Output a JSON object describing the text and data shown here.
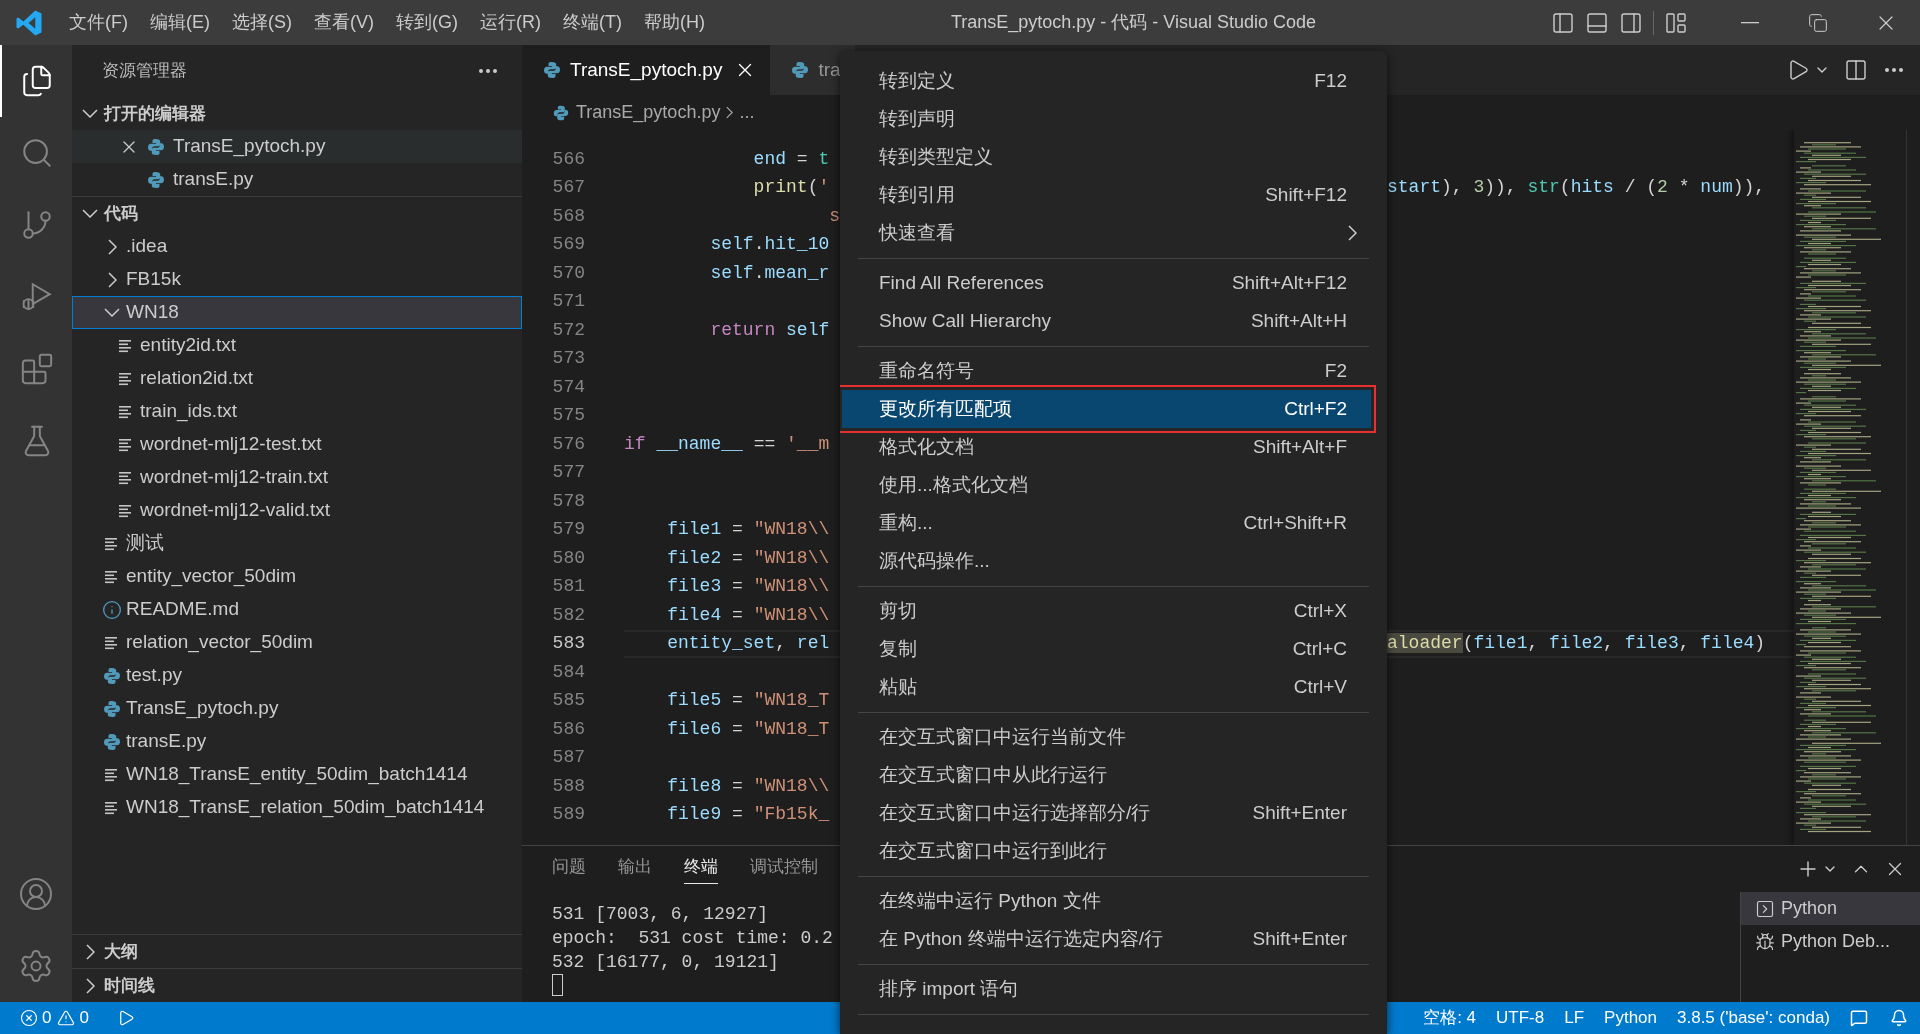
{
  "title_bar": {
    "menus": [
      "文件(F)",
      "编辑(E)",
      "选择(S)",
      "查看(V)",
      "转到(G)",
      "运行(R)",
      "终端(T)",
      "帮助(H)"
    ],
    "title": "TransE_pytoch.py - 代码 - Visual Studio Code"
  },
  "activity_bar": [
    {
      "kind": "files",
      "selected": true
    },
    {
      "kind": "search",
      "selected": false
    },
    {
      "kind": "scm",
      "selected": false
    },
    {
      "kind": "debug",
      "selected": false
    },
    {
      "kind": "extensions",
      "selected": false
    },
    {
      "kind": "testing",
      "selected": false
    }
  ],
  "explorer": {
    "title": "资源管理器",
    "open_editors": {
      "title": "打开的编辑器",
      "expanded": true,
      "items": [
        {
          "name": "TransE_pytoch.py",
          "selected": true
        },
        {
          "name": "transE.py",
          "selected": false
        }
      ]
    },
    "folder": {
      "title": "代码",
      "expanded": true,
      "items": [
        {
          "name": ".idea",
          "kind": "folder",
          "expanded": false,
          "selected": false
        },
        {
          "name": "FB15k",
          "kind": "folder",
          "expanded": false,
          "selected": false
        },
        {
          "name": "WN18",
          "kind": "folder",
          "expanded": true,
          "selected": true,
          "children": [
            {
              "name": "entity2id.txt",
              "kind": "text",
              "selected": false
            },
            {
              "name": "relation2id.txt",
              "kind": "text",
              "selected": false
            },
            {
              "name": "train_ids.txt",
              "kind": "text",
              "selected": false
            },
            {
              "name": "wordnet-mlj12-test.txt",
              "kind": "text",
              "selected": false
            },
            {
              "name": "wordnet-mlj12-train.txt",
              "kind": "text",
              "selected": false
            },
            {
              "name": "wordnet-mlj12-valid.txt",
              "kind": "text",
              "selected": false
            }
          ]
        },
        {
          "name": "测试",
          "kind": "text",
          "selected": false
        },
        {
          "name": "entity_vector_50dim",
          "kind": "text",
          "selected": false
        },
        {
          "name": "README.md",
          "kind": "info",
          "selected": false
        },
        {
          "name": "relation_vector_50dim",
          "kind": "text",
          "selected": false
        },
        {
          "name": "test.py",
          "kind": "python",
          "selected": false
        },
        {
          "name": "TransE_pytoch.py",
          "kind": "python",
          "selected": false
        },
        {
          "name": "transE.py",
          "kind": "python",
          "selected": false
        },
        {
          "name": "WN18_TransE_entity_50dim_batch1414",
          "kind": "text",
          "selected": false
        },
        {
          "name": "WN18_TransE_relation_50dim_batch1414",
          "kind": "text",
          "selected": false
        }
      ]
    },
    "bottom_sections": [
      {
        "title": "大纲",
        "expanded": false
      },
      {
        "title": "时间线",
        "expanded": false
      }
    ]
  },
  "editor": {
    "tabs": [
      {
        "label": "TransE_pytoch.py",
        "selected": true
      },
      {
        "label": "tra",
        "selected": false
      }
    ],
    "breadcrumb": [
      "TransE_pytoch.py",
      "..."
    ],
    "lines": [
      {
        "number": "566",
        "current": false,
        "left": [
          {
            "text": "            end",
            "kind": "var"
          },
          {
            "text": " = ",
            "kind": "op"
          },
          {
            "text": "t",
            "kind": "cls"
          }
        ]
      },
      {
        "number": "567",
        "current": false,
        "left": [
          {
            "text": "            print",
            "kind": "fn"
          },
          {
            "text": "(",
            "kind": "op"
          },
          {
            "text": "'",
            "kind": "str"
          }
        ],
        "right": [
          {
            "text": "start",
            "kind": "var"
          },
          {
            "text": "), ",
            "kind": "op"
          },
          {
            "text": "3",
            "kind": "num"
          },
          {
            "text": ")), ",
            "kind": "op"
          },
          {
            "text": "str",
            "kind": "cls"
          },
          {
            "text": "(",
            "kind": "op"
          },
          {
            "text": "hits",
            "kind": "var"
          },
          {
            "text": " / (",
            "kind": "op"
          },
          {
            "text": "2",
            "kind": "num"
          },
          {
            "text": " * ",
            "kind": "op"
          },
          {
            "text": "num",
            "kind": "var"
          },
          {
            "text": ")),",
            "kind": "op"
          }
        ]
      },
      {
        "number": "568",
        "current": false,
        "left": [
          {
            "text": "                   s",
            "kind": "str"
          }
        ]
      },
      {
        "number": "569",
        "current": false,
        "left": [
          {
            "text": "        self",
            "kind": "var"
          },
          {
            "text": ".",
            "kind": "op"
          },
          {
            "text": "hit_10",
            "kind": "var"
          }
        ]
      },
      {
        "number": "570",
        "current": false,
        "left": [
          {
            "text": "        self",
            "kind": "var"
          },
          {
            "text": ".",
            "kind": "op"
          },
          {
            "text": "mean_r",
            "kind": "var"
          }
        ]
      },
      {
        "number": "571",
        "current": false
      },
      {
        "number": "572",
        "current": false,
        "left": [
          {
            "text": "        return",
            "kind": "kw"
          },
          {
            "text": " self",
            "kind": "var"
          }
        ]
      },
      {
        "number": "573",
        "current": false
      },
      {
        "number": "574",
        "current": false
      },
      {
        "number": "575",
        "current": false
      },
      {
        "number": "576",
        "current": false,
        "left": [
          {
            "text": "if",
            "kind": "kw"
          },
          {
            "text": " __name__",
            "kind": "var"
          },
          {
            "text": " == ",
            "kind": "op"
          },
          {
            "text": "'__m",
            "kind": "str"
          }
        ]
      },
      {
        "number": "577",
        "current": false
      },
      {
        "number": "578",
        "current": false
      },
      {
        "number": "579",
        "current": false,
        "left": [
          {
            "text": "    file1",
            "kind": "var"
          },
          {
            "text": " = ",
            "kind": "op"
          },
          {
            "text": "\"WN18\\\\",
            "kind": "str"
          }
        ]
      },
      {
        "number": "580",
        "current": false,
        "left": [
          {
            "text": "    file2",
            "kind": "var"
          },
          {
            "text": " = ",
            "kind": "op"
          },
          {
            "text": "\"WN18\\\\",
            "kind": "str"
          }
        ]
      },
      {
        "number": "581",
        "current": false,
        "left": [
          {
            "text": "    file3",
            "kind": "var"
          },
          {
            "text": " = ",
            "kind": "op"
          },
          {
            "text": "\"WN18\\\\",
            "kind": "str"
          }
        ]
      },
      {
        "number": "582",
        "current": false,
        "left": [
          {
            "text": "    file4",
            "kind": "var"
          },
          {
            "text": " = ",
            "kind": "op"
          },
          {
            "text": "\"WN18\\\\",
            "kind": "str"
          }
        ]
      },
      {
        "number": "583",
        "current": true,
        "left": [
          {
            "text": "    entity_set",
            "kind": "var"
          },
          {
            "text": ", ",
            "kind": "op"
          },
          {
            "text": "rel",
            "kind": "var"
          }
        ],
        "right": [
          {
            "text": "aloader",
            "kind": "match"
          },
          {
            "text": "(",
            "kind": "op"
          },
          {
            "text": "file1",
            "kind": "var"
          },
          {
            "text": ", ",
            "kind": "op"
          },
          {
            "text": "file2",
            "kind": "var"
          },
          {
            "text": ", ",
            "kind": "op"
          },
          {
            "text": "file3",
            "kind": "var"
          },
          {
            "text": ", ",
            "kind": "op"
          },
          {
            "text": "file4",
            "kind": "var"
          },
          {
            "text": ")",
            "kind": "op"
          }
        ]
      },
      {
        "number": "584",
        "current": false
      },
      {
        "number": "585",
        "current": false,
        "left": [
          {
            "text": "    file5",
            "kind": "var"
          },
          {
            "text": " = ",
            "kind": "op"
          },
          {
            "text": "\"WN18_T",
            "kind": "str"
          }
        ]
      },
      {
        "number": "586",
        "current": false,
        "left": [
          {
            "text": "    file6",
            "kind": "var"
          },
          {
            "text": " = ",
            "kind": "op"
          },
          {
            "text": "\"WN18_T",
            "kind": "str"
          }
        ]
      },
      {
        "number": "587",
        "current": false
      },
      {
        "number": "588",
        "current": false,
        "left": [
          {
            "text": "    file8",
            "kind": "var"
          },
          {
            "text": " = ",
            "kind": "op"
          },
          {
            "text": "\"WN18\\\\",
            "kind": "str"
          }
        ]
      },
      {
        "number": "589",
        "current": false,
        "left": [
          {
            "text": "    file9",
            "kind": "var"
          },
          {
            "text": " = ",
            "kind": "op"
          },
          {
            "text": "\"Fb15k_",
            "kind": "str"
          }
        ]
      }
    ]
  },
  "panel": {
    "tabs": [
      {
        "label": "问题",
        "selected": false
      },
      {
        "label": "输出",
        "selected": false
      },
      {
        "label": "终端",
        "selected": true
      },
      {
        "label": "调试控制",
        "selected": false
      }
    ],
    "terminal_lines": [
      "531 [7003, 6, 12927]",
      "epoch:  531 cost time: 0.2",
      "532 [16177, 0, 19121]"
    ],
    "terminals": [
      {
        "label": "Python",
        "kind": "shell",
        "selected": true
      },
      {
        "label": "Python Deb...",
        "kind": "debug",
        "selected": false
      }
    ]
  },
  "context_menu": {
    "groups": [
      {
        "items": [
          {
            "label": "转到定义",
            "shortcut": "F12",
            "kind": "command",
            "selected": false
          },
          {
            "label": "转到声明",
            "kind": "command",
            "selected": false
          },
          {
            "label": "转到类型定义",
            "kind": "command",
            "selected": false
          },
          {
            "label": "转到引用",
            "shortcut": "Shift+F12",
            "kind": "command",
            "selected": false
          },
          {
            "label": "快速查看",
            "kind": "submenu",
            "selected": false
          }
        ]
      },
      {
        "items": [
          {
            "label": "Find All References",
            "shortcut": "Shift+Alt+F12",
            "kind": "command",
            "selected": false
          },
          {
            "label": "Show Call Hierarchy",
            "shortcut": "Shift+Alt+H",
            "kind": "command",
            "selected": false
          }
        ]
      },
      {
        "items": [
          {
            "label": "重命名符号",
            "shortcut": "F2",
            "kind": "command",
            "selected": false
          },
          {
            "label": "更改所有匹配项",
            "shortcut": "Ctrl+F2",
            "kind": "command",
            "selected": true
          },
          {
            "label": "格式化文档",
            "shortcut": "Shift+Alt+F",
            "kind": "command",
            "selected": false
          },
          {
            "label": "使用...格式化文档",
            "kind": "command",
            "selected": false
          },
          {
            "label": "重构...",
            "shortcut": "Ctrl+Shift+R",
            "kind": "command",
            "selected": false
          },
          {
            "label": "源代码操作...",
            "kind": "command",
            "selected": false
          }
        ]
      },
      {
        "items": [
          {
            "label": "剪切",
            "shortcut": "Ctrl+X",
            "kind": "command",
            "selected": false
          },
          {
            "label": "复制",
            "shortcut": "Ctrl+C",
            "kind": "command",
            "selected": false
          },
          {
            "label": "粘贴",
            "shortcut": "Ctrl+V",
            "kind": "command",
            "selected": false
          }
        ]
      },
      {
        "items": [
          {
            "label": "在交互式窗口中运行当前文件",
            "kind": "command",
            "selected": false
          },
          {
            "label": "在交互式窗口中从此行运行",
            "kind": "command",
            "selected": false
          },
          {
            "label": "在交互式窗口中运行选择部分/行",
            "shortcut": "Shift+Enter",
            "kind": "command",
            "selected": false
          },
          {
            "label": "在交互式窗口中运行到此行",
            "kind": "command",
            "selected": false
          }
        ]
      },
      {
        "items": [
          {
            "label": "在终端中运行 Python 文件",
            "kind": "command",
            "selected": false
          },
          {
            "label": "在 Python 终端中运行选定内容/行",
            "shortcut": "Shift+Enter",
            "kind": "command",
            "selected": false
          }
        ]
      },
      {
        "items": [
          {
            "label": "排序 import 语句",
            "kind": "command",
            "selected": false
          }
        ]
      }
    ]
  },
  "status_bar": {
    "errors": "0",
    "warnings": "0",
    "right": [
      "空格: 4",
      "UTF-8",
      "LF",
      "Python",
      "3.8.5 ('base': conda)"
    ]
  }
}
